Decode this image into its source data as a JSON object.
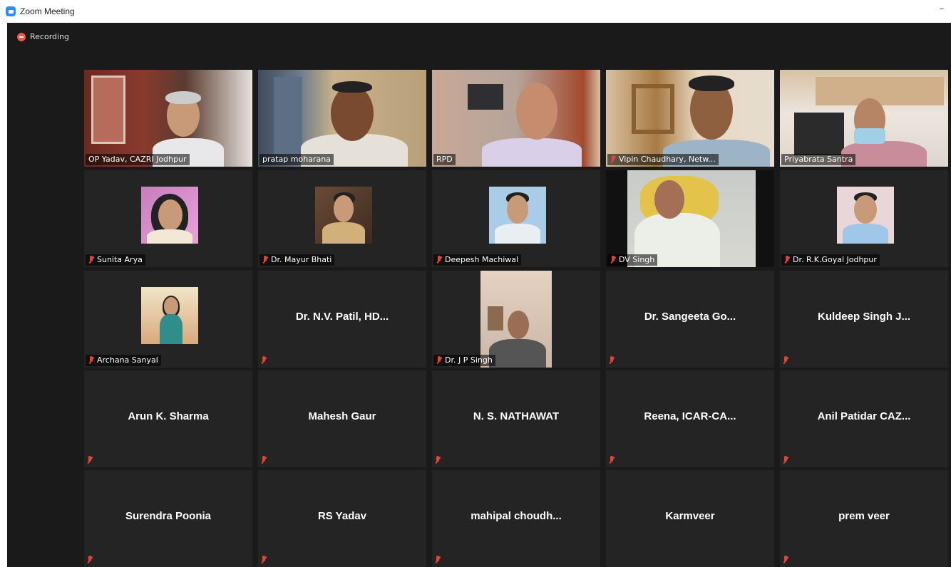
{
  "window": {
    "title": "Zoom Meeting",
    "minimize_glyph": "–",
    "app_icon": "zoom-camera-icon"
  },
  "status": {
    "recording_label": "Recording",
    "recording_color": "#e8594c"
  },
  "colors": {
    "background": "#1a1a1a",
    "tile": "#242424",
    "active_speaker_border": "#d3e05a",
    "mute_icon": "#e0453c"
  },
  "participants": [
    {
      "name": "OP Yadav, CAZRI Jodhpur",
      "video": true,
      "muted": false
    },
    {
      "name": "pratap moharana",
      "video": true,
      "muted": false,
      "active_speaker": true
    },
    {
      "name": "RPD",
      "video": true,
      "muted": false
    },
    {
      "name": "Vipin Chaudhary, Netw...",
      "video": true,
      "muted": true
    },
    {
      "name": "Priyabrata Santra",
      "video": true,
      "muted": false
    },
    {
      "name": "Sunita Arya",
      "video": false,
      "profile_photo": true,
      "muted": true
    },
    {
      "name": "Dr. Mayur Bhati",
      "video": false,
      "profile_photo": true,
      "muted": true
    },
    {
      "name": "Deepesh Machiwal",
      "video": false,
      "profile_photo": true,
      "muted": true
    },
    {
      "name": "DV Singh",
      "video": true,
      "muted": true
    },
    {
      "name": "Dr. R.K.Goyal Jodhpur",
      "video": false,
      "profile_photo": true,
      "muted": true
    },
    {
      "name": "Archana Sanyal",
      "video": false,
      "profile_photo": true,
      "muted": true
    },
    {
      "name": "Dr. N.V. Patil, HD...",
      "video": false,
      "muted": true
    },
    {
      "name": "Dr. J P Singh",
      "video": true,
      "muted": true
    },
    {
      "name": "Dr. Sangeeta Go...",
      "video": false,
      "muted": true
    },
    {
      "name": "Kuldeep Singh J...",
      "video": false,
      "muted": true
    },
    {
      "name": "Arun K. Sharma",
      "video": false,
      "muted": true
    },
    {
      "name": "Mahesh Gaur",
      "video": false,
      "muted": true
    },
    {
      "name": "N. S. NATHAWAT",
      "video": false,
      "muted": true
    },
    {
      "name": "Reena,  ICAR-CA...",
      "video": false,
      "muted": true
    },
    {
      "name": "Anil Patidar CAZ...",
      "video": false,
      "muted": true
    },
    {
      "name": "Surendra Poonia",
      "video": false,
      "muted": true
    },
    {
      "name": "RS Yadav",
      "video": false,
      "muted": true
    },
    {
      "name": "mahipal  choudh...",
      "video": false,
      "muted": true
    },
    {
      "name": "Karmveer",
      "video": false,
      "muted": false
    },
    {
      "name": "prem veer",
      "video": false,
      "muted": true
    }
  ]
}
